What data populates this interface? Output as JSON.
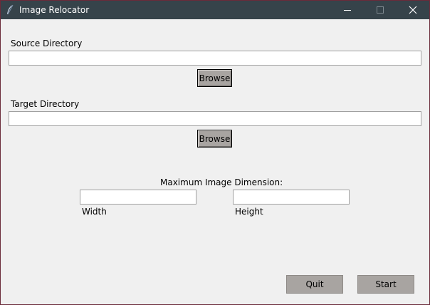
{
  "window": {
    "title": "Image Relocator",
    "controls": {
      "minimize": "minimize-icon",
      "maximize": "maximize-icon",
      "close": "close-icon"
    }
  },
  "source": {
    "label": "Source Directory",
    "value": "",
    "browse_label": "Browse"
  },
  "target": {
    "label": "Target Directory",
    "value": "",
    "browse_label": "Browse"
  },
  "dimension": {
    "heading": "Maximum Image Dimension:",
    "width_label": "Width",
    "width_value": "",
    "height_label": "Height",
    "height_value": ""
  },
  "actions": {
    "quit_label": "Quit",
    "start_label": "Start"
  },
  "colors": {
    "titlebar": "#36434a",
    "window_bg": "#f0f0f0",
    "button_bg": "#a8a4a1",
    "border_accent": "#6b2b3a"
  }
}
